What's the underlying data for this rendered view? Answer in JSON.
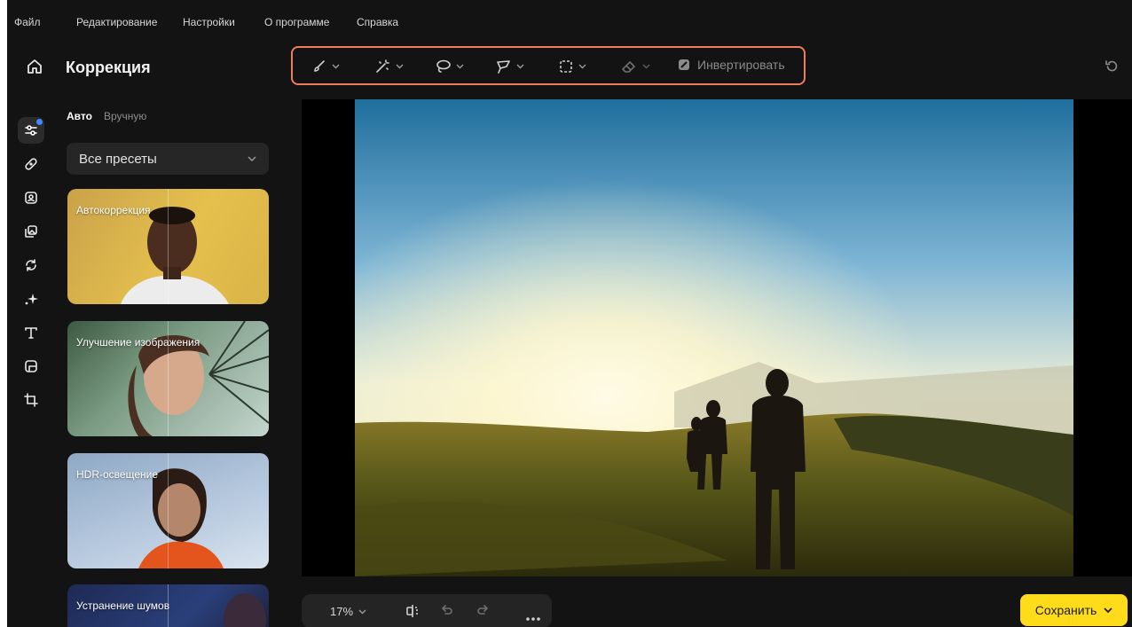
{
  "menu": {
    "file": "Файл",
    "edit": "Редактирование",
    "settings": "Настройки",
    "about": "О программе",
    "help": "Справка"
  },
  "panel": {
    "title": "Коррекция",
    "tabs": {
      "auto": "Авто",
      "manual": "Вручную"
    },
    "preset_select": "Все пресеты"
  },
  "toolbar": {
    "invert_label": "Инвертировать",
    "tools": [
      "brush-icon",
      "magic-wand-icon",
      "lasso-icon",
      "polygon-lasso-icon",
      "rect-select-icon",
      "eraser-icon"
    ]
  },
  "presets": [
    {
      "label": "Автокоррекция"
    },
    {
      "label": "Улучшение изображения"
    },
    {
      "label": "HDR-освещение"
    },
    {
      "label": "Устранение шумов"
    }
  ],
  "bottom": {
    "zoom": "17%",
    "save_label": "Сохранить"
  },
  "colors": {
    "app_bg": "#131313",
    "toolbar_highlight": "#ef7d5b",
    "save_button": "#ffdc1a",
    "active_dot": "#3d8bff"
  }
}
